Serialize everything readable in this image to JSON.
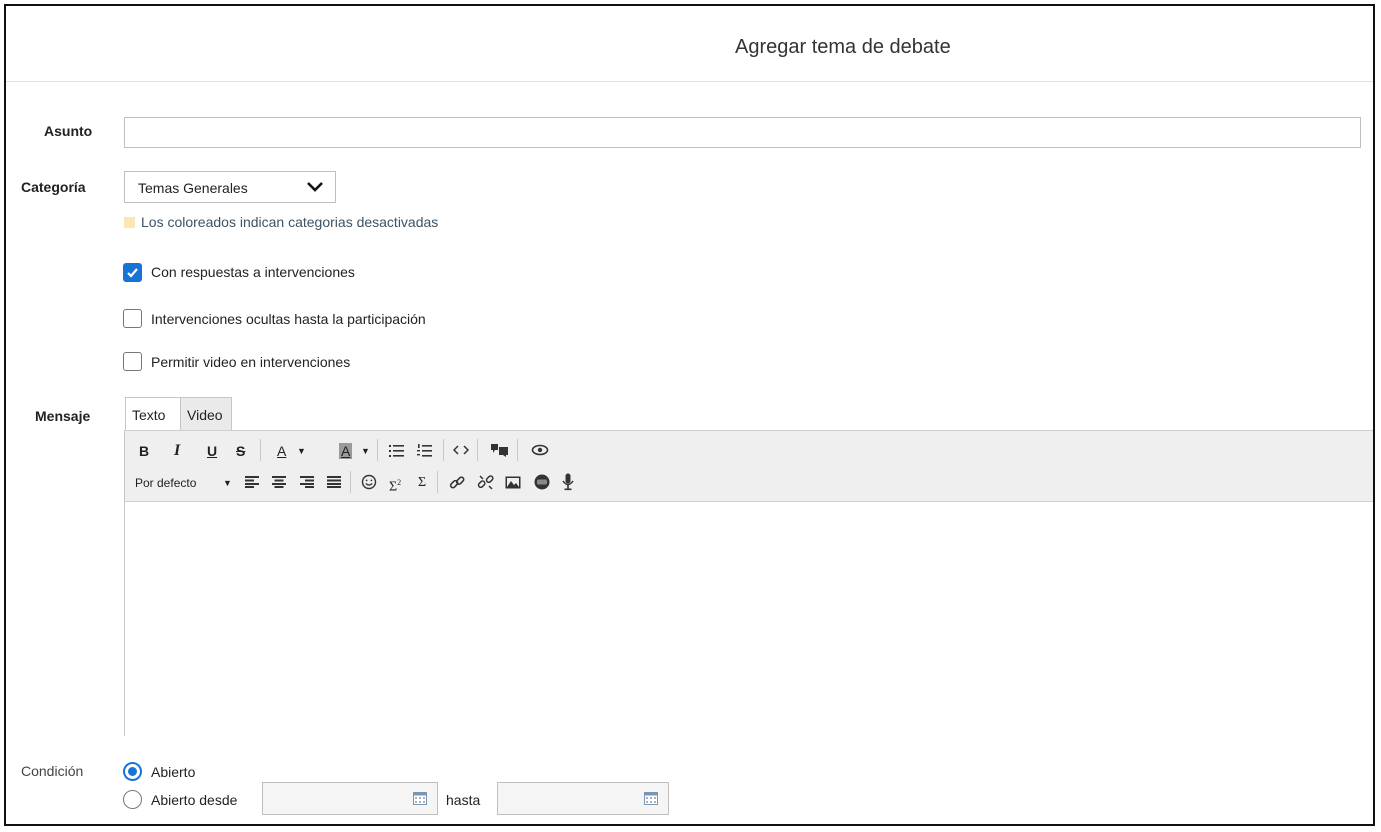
{
  "header": {
    "title": "Agregar tema de debate"
  },
  "form": {
    "subject_label": "Asunto",
    "subject_value": "",
    "category_label": "Categoría",
    "category_value": "Temas Generales",
    "category_hint": "Los coloreados indican categorias desactivadas",
    "options": [
      {
        "label": "Con respuestas a intervenciones",
        "checked": true
      },
      {
        "label": "Intervenciones ocultas hasta la participación",
        "checked": false
      },
      {
        "label": "Permitir video en intervenciones",
        "checked": false
      }
    ],
    "message_label": "Mensaje",
    "tabs": [
      {
        "label": "Texto",
        "active": true
      },
      {
        "label": "Video",
        "active": false
      }
    ],
    "toolbar": {
      "bold": "B",
      "italic": "I",
      "underline": "U",
      "strike": "S",
      "text_color": "A",
      "bg_color": "A",
      "font_style": "Por defecto",
      "sub": "Σ",
      "sum": "Σ"
    },
    "message_value": "",
    "condition_label": "Condición",
    "condition_options": [
      {
        "label": "Abierto",
        "selected": true
      },
      {
        "label": "Abierto desde",
        "selected": false
      }
    ],
    "date_from": "",
    "until_label": "hasta",
    "date_to": ""
  },
  "colors": {
    "accent": "#1873d6",
    "hint_swatch": "#fbe7b4",
    "toolbar_bg": "#efefef"
  }
}
